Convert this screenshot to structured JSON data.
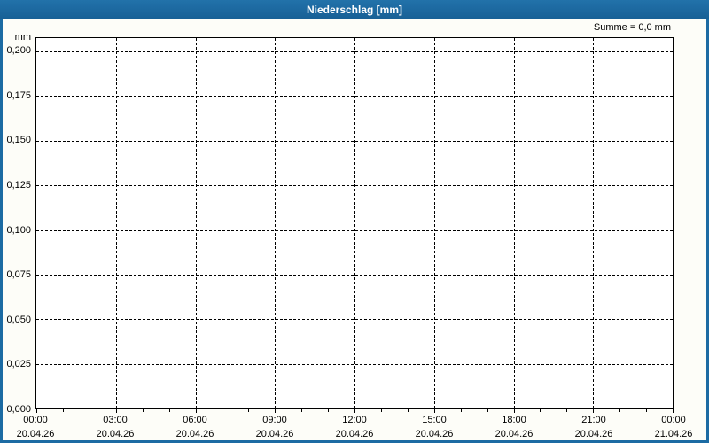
{
  "window": {
    "title": "Niederschlag [mm]"
  },
  "summary": {
    "label": "Summe = 0,0 mm"
  },
  "colors": {
    "titlebar": "#1c6ba3",
    "titlebar_gradient_top": "#2272aa",
    "titlebar_gradient_bottom": "#175f95",
    "window_border": "#1c6ba3",
    "grid": "#000000",
    "axis": "#000000",
    "text": "#000000",
    "title_text": "#ffffff",
    "plot_background": "#ffffff",
    "background": "#fdfdf8"
  },
  "chart_data": {
    "type": "line",
    "title": "Niederschlag [mm]",
    "subtitle": "Summe = 0,0 mm",
    "xlabel": "",
    "ylabel": "mm",
    "y_unit_label": "mm",
    "ylim": [
      0,
      0.2075
    ],
    "grid": "dashed",
    "legend_position": "none",
    "y_ticks": [
      0.0,
      0.025,
      0.05,
      0.075,
      0.1,
      0.125,
      0.15,
      0.175,
      0.2
    ],
    "y_tick_labels": [
      "0,000",
      "0,025",
      "0,050",
      "0,075",
      "0,100",
      "0,125",
      "0,150",
      "0,175",
      "0,200"
    ],
    "x_total_hours": 24,
    "x_major_tick_interval_hours": 3,
    "x_minor_tick_interval_hours": 1,
    "x_ticks": [
      {
        "time": "00:00",
        "date": "20.04.26"
      },
      {
        "time": "03:00",
        "date": "20.04.26"
      },
      {
        "time": "06:00",
        "date": "20.04.26"
      },
      {
        "time": "09:00",
        "date": "20.04.26"
      },
      {
        "time": "12:00",
        "date": "20.04.26"
      },
      {
        "time": "15:00",
        "date": "20.04.26"
      },
      {
        "time": "18:00",
        "date": "20.04.26"
      },
      {
        "time": "21:00",
        "date": "20.04.26"
      },
      {
        "time": "00:00",
        "date": "21.04.26"
      }
    ],
    "series": [
      {
        "name": "Niederschlag",
        "values": [],
        "sum_mm": 0.0
      }
    ]
  }
}
